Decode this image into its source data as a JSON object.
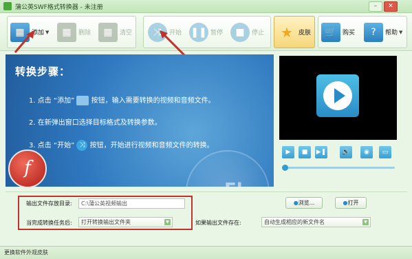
{
  "window": {
    "title": "蒲公英SWF格式转换器 - 未注册"
  },
  "toolbar": {
    "add": "添加",
    "delete": "删除",
    "clear": "清空",
    "start": "开始",
    "pause": "暂停",
    "stop": "停止",
    "skin": "皮肤",
    "buy": "购买",
    "help": "帮助"
  },
  "banner": {
    "heading": "转换步骤：",
    "step1_a": "1. 点击 “添加”",
    "step1_b": " 按钮，输入需要转换的视频和音频文件。",
    "step2": "2. 在新弹出窗口选择目标格式及转换参数。",
    "step3_a": "3. 点击 “开始”",
    "step3_b": " 按钮，开始进行视频和音频文件的转换。",
    "watermark": "Fl"
  },
  "options": {
    "output_dir_label": "输出文件存放目录:",
    "output_dir_value": "C:\\蒲公英视频输出",
    "browse": "浏览...",
    "open": "打开",
    "after_done_label": "当完成转换任务后:",
    "after_done_value": "打开转换输出文件夹",
    "if_exists_label": "如果输出文件存在:",
    "if_exists_value": "自动生成相应的新文件名"
  },
  "statusbar": {
    "text": "更换软件外观皮肤"
  },
  "colors": {
    "accent_red": "#c0322b",
    "banner_blue": "#2f78bf"
  }
}
